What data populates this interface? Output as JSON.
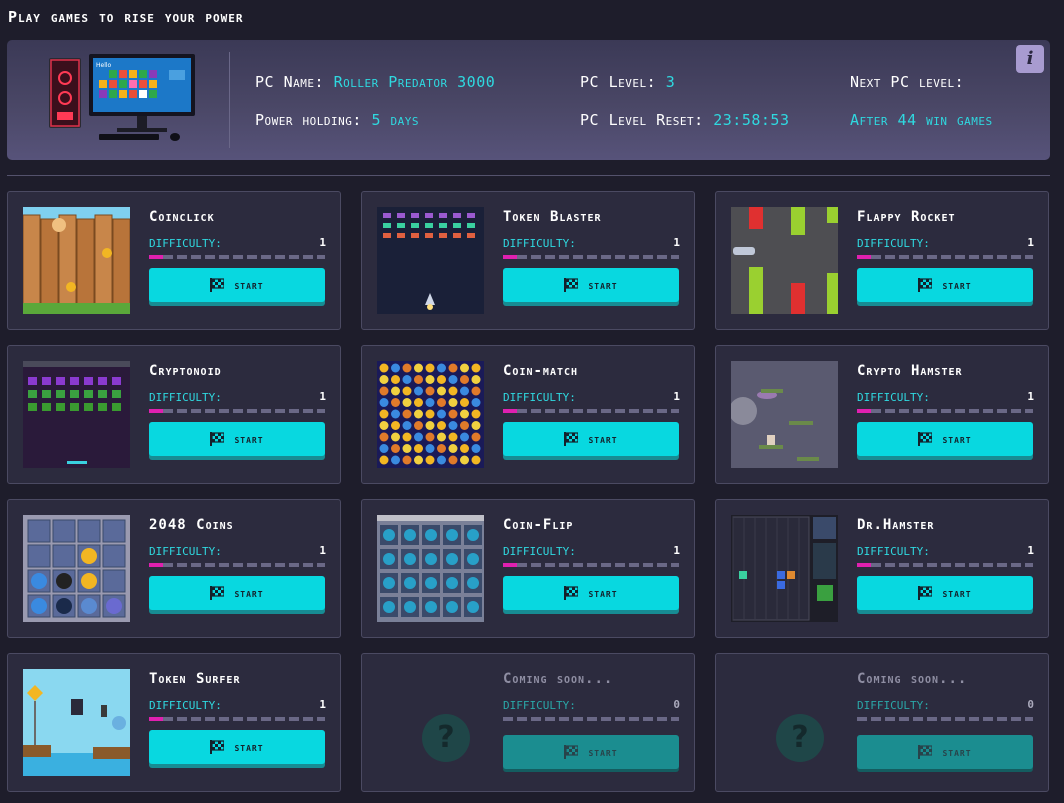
{
  "page": {
    "title": "Play games to rise your power"
  },
  "pc": {
    "name_label": "PC Name: ",
    "name_value": "Roller Predator 3000",
    "level_label": "PC Level: ",
    "level_value": "3",
    "next_label": "Next PC level:",
    "holding_label": "Power holding: ",
    "holding_value": "5 days",
    "reset_label": "PC Level Reset: ",
    "reset_value": "23:58:53",
    "next_value": "After 44 win games",
    "info_button": "i",
    "monitor_text": "Hello"
  },
  "labels": {
    "difficulty": "Difficulty:",
    "start": "start"
  },
  "games": [
    {
      "title": "Coinclick",
      "difficulty": "1",
      "thumb": "coinclick"
    },
    {
      "title": "Token Blaster",
      "difficulty": "1",
      "thumb": "token-blaster"
    },
    {
      "title": "Flappy Rocket",
      "difficulty": "1",
      "thumb": "flappy-rocket"
    },
    {
      "title": "Cryptonoid",
      "difficulty": "1",
      "thumb": "cryptonoid"
    },
    {
      "title": "Coin-match",
      "difficulty": "1",
      "thumb": "coin-match"
    },
    {
      "title": "Crypto Hamster",
      "difficulty": "1",
      "thumb": "crypto-hamster"
    },
    {
      "title": "2048 Coins",
      "difficulty": "1",
      "thumb": "2048-coins"
    },
    {
      "title": "Coin-Flip",
      "difficulty": "1",
      "thumb": "coin-flip"
    },
    {
      "title": "Dr.Hamster",
      "difficulty": "1",
      "thumb": "dr-hamster"
    },
    {
      "title": "Token Surfer",
      "difficulty": "1",
      "thumb": "token-surfer"
    },
    {
      "title": "Coming soon...",
      "difficulty": "0",
      "thumb": "question-icon"
    },
    {
      "title": "Coming soon...",
      "difficulty": "0",
      "thumb": "question-icon"
    }
  ],
  "colors": {
    "accent": "#08d8e0",
    "difficulty_fill": "#e020b0",
    "background": "#1e1d2b",
    "card": "#2c2b3e"
  }
}
